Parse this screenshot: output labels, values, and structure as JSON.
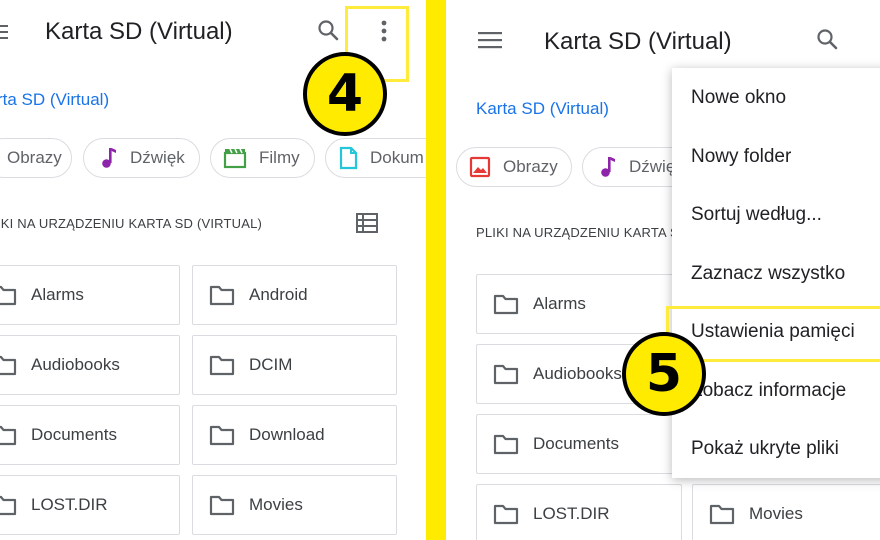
{
  "left": {
    "title": "Karta SD (Virtual)",
    "breadcrumb": "rta SD (Virtual)",
    "chips": [
      {
        "label": "Obrazy",
        "icon": "image-icon",
        "color": "#e53935"
      },
      {
        "label": "Dźwięk",
        "icon": "music-note-icon",
        "color": "#8e24aa"
      },
      {
        "label": "Filmy",
        "icon": "movie-icon",
        "color": "#43a047"
      },
      {
        "label": "Dokum",
        "icon": "document-icon",
        "color": "#26c6da"
      }
    ],
    "section_header": "IKI NA URZĄDZENIU KARTA SD (VIRTUAL)",
    "folders": [
      "Alarms",
      "Android",
      "Audiobooks",
      "DCIM",
      "Documents",
      "Download",
      "LOST.DIR",
      "Movies"
    ]
  },
  "right": {
    "title": "Karta SD (Virtual)",
    "breadcrumb": "Karta SD (Virtual)",
    "chips": [
      {
        "label": "Obrazy",
        "icon": "image-icon",
        "color": "#e53935"
      },
      {
        "label": "Dźwię",
        "icon": "music-note-icon",
        "color": "#8e24aa"
      }
    ],
    "section_header": "PLIKI NA URZĄDZENIU KARTA S",
    "folders": [
      "Alarms",
      "Audiobooks",
      "Documents",
      "LOST.DIR",
      "Movies"
    ],
    "menu": [
      "Nowe okno",
      "Nowy folder",
      "Sortuj według...",
      "Zaznacz wszystko",
      "Ustawienia pamięci",
      "Zobacz informacje",
      "Pokaż ukryte pliki"
    ]
  },
  "annotations": {
    "step_4": "4",
    "step_5": "5",
    "highlight_color": "#ffeb3b"
  },
  "colors": {
    "accent": "#1a73e8",
    "divider": "#ffeb00",
    "folder_icon": "#5f6368"
  }
}
